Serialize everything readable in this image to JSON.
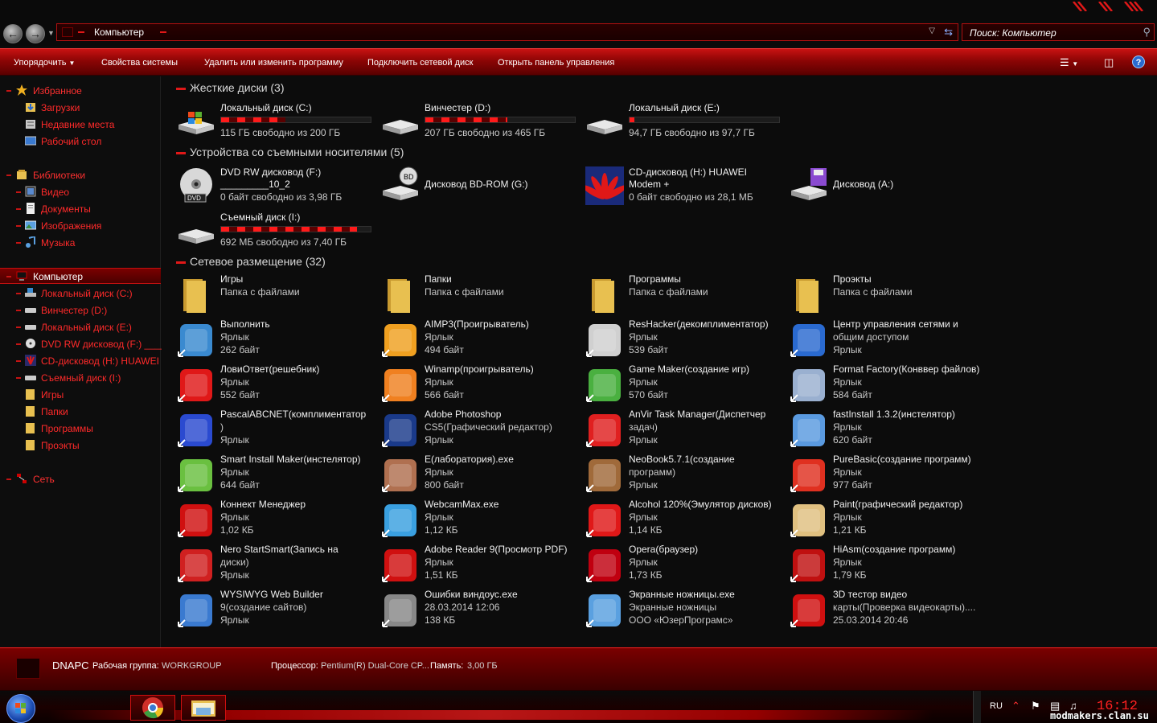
{
  "window": {
    "address": "Компьютер",
    "search_placeholder": "Поиск: Компьютер"
  },
  "toolbar": {
    "organize": "Упорядочить",
    "system_props": "Свойства системы",
    "uninstall": "Удалить или изменить программу",
    "map_drive": "Подключить сетевой диск",
    "control_panel": "Открыть панель управления"
  },
  "sidebar": {
    "favorites": {
      "label": "Избранное",
      "items": [
        {
          "label": "Загрузки"
        },
        {
          "label": "Недавние места"
        },
        {
          "label": "Рабочий стол"
        }
      ]
    },
    "libraries": {
      "label": "Библиотеки",
      "items": [
        {
          "label": "Видео"
        },
        {
          "label": "Документы"
        },
        {
          "label": "Изображения"
        },
        {
          "label": "Музыка"
        }
      ]
    },
    "computer": {
      "label": "Компьютер",
      "items": [
        {
          "label": "Локальный диск (C:)"
        },
        {
          "label": "Винчестер (D:)"
        },
        {
          "label": "Локальный диск (E:)"
        },
        {
          "label": "DVD RW дисковод (F:) ____"
        },
        {
          "label": "CD-дисковод (H:) HUAWEI"
        },
        {
          "label": "Съемный диск (I:)"
        },
        {
          "label": "Игры"
        },
        {
          "label": "Папки"
        },
        {
          "label": "Программы"
        },
        {
          "label": "Проэкты"
        }
      ]
    },
    "network": {
      "label": "Сеть"
    }
  },
  "groups": {
    "hdd": "Жесткие диски (3)",
    "removable": "Устройства со съемными носителями (5)",
    "network": "Сетевое размещение (32)"
  },
  "hdd": [
    {
      "name": "Локальный диск (C:)",
      "free": "115 ГБ свободно из 200 ГБ",
      "used_fraction": 0.43
    },
    {
      "name": "Винчестер (D:)",
      "free": "207 ГБ свободно из 465 ГБ",
      "used_fraction": 0.55
    },
    {
      "name": "Локальный диск (E:)",
      "free": "94,7 ГБ свободно из 97,7 ГБ",
      "used_fraction": 0.03
    }
  ],
  "removable": [
    {
      "l1": "DVD RW дисковод (F:)",
      "l2": "_________10_2",
      "l3": "0 байт свободно из 3,98 ГБ"
    },
    {
      "l1": "Дисковод BD-ROM (G:)"
    },
    {
      "l1": "CD-дисковод (H:) HUAWEI",
      "l2": "Modem +",
      "l3": "0 байт свободно из 28,1 МБ"
    },
    {
      "l1": "Дисковод (A:)"
    },
    {
      "l1": "Съемный диск (I:)",
      "l3": "692 МБ свободно из 7,40 ГБ",
      "used_fraction": 0.91
    }
  ],
  "network_items": [
    {
      "l1": "Игры",
      "l2": "Папка с файлами",
      "icon": "folder-icon"
    },
    {
      "l1": "Папки",
      "l2": "Папка с файлами",
      "icon": "folder-icon"
    },
    {
      "l1": "Программы",
      "l2": "Папка с файлами",
      "icon": "folder-icon"
    },
    {
      "l1": "Проэкты",
      "l2": "Папка с файлами",
      "icon": "folder-icon"
    },
    {
      "l1": "Выполнить",
      "l2": "Ярлык",
      "l3": "262 байт",
      "icon": "run-icon"
    },
    {
      "l1": "AIMP3(Проигрыватель)",
      "l2": "Ярлык",
      "l3": "494 байт",
      "icon": "aimp-icon"
    },
    {
      "l1": "ResHacker(декомплиментатор)",
      "l2": "Ярлык",
      "l3": "539 байт",
      "icon": "reshacker-icon"
    },
    {
      "l1": "Центр управления сетями и",
      "l2": "общим доступом",
      "l3": "Ярлык",
      "icon": "network-center-icon"
    },
    {
      "l1": "ЛовиОтвет(решебник)",
      "l2": "Ярлык",
      "l3": "552 байт",
      "icon": "loviotvet-icon"
    },
    {
      "l1": "Winamp(проигрыватель)",
      "l2": "Ярлык",
      "l3": "566 байт",
      "icon": "winamp-icon"
    },
    {
      "l1": "Game Maker(создание игр)",
      "l2": "Ярлык",
      "l3": "570 байт",
      "icon": "gamemaker-icon"
    },
    {
      "l1": "Format Factory(Конввер файлов)",
      "l2": "Ярлык",
      "l3": "584 байт",
      "icon": "formatfactory-icon"
    },
    {
      "l1": "PascalABCNET(комплиментатор",
      "l2": ")",
      "l3": "Ярлык",
      "icon": "pascal-icon"
    },
    {
      "l1": "Adobe Photoshop",
      "l2": "CS5(Графический редактор)",
      "l3": "Ярлык",
      "icon": "photoshop-icon"
    },
    {
      "l1": "AnVir Task Manager(Диспетчер",
      "l2": "задач)",
      "l3": "Ярлык",
      "icon": "anvir-icon"
    },
    {
      "l1": "fastInstall 1.3.2(инстелятор)",
      "l2": "Ярлык",
      "l3": "620 байт",
      "icon": "fastinstall-icon"
    },
    {
      "l1": "Smart Install Maker(инстелятор)",
      "l2": "Ярлык",
      "l3": "644 байт",
      "icon": "smartinstall-icon"
    },
    {
      "l1": "E(лаборатория).exe",
      "l2": "Ярлык",
      "l3": "800 байт",
      "icon": "molecule-icon"
    },
    {
      "l1": "NeoBook5.7.1(создание",
      "l2": "программ)",
      "l3": "Ярлык",
      "icon": "neobook-icon"
    },
    {
      "l1": "PureBasic(создание программ)",
      "l2": "Ярлык",
      "l3": "977 байт",
      "icon": "purebasic-icon"
    },
    {
      "l1": "Коннект Менеджер",
      "l2": "Ярлык",
      "l3": "1,02 КБ",
      "icon": "connect-manager-icon"
    },
    {
      "l1": "WebcamMax.exe",
      "l2": "Ярлык",
      "l3": "1,12 КБ",
      "icon": "webcam-icon"
    },
    {
      "l1": "Alcohol 120%(Эмулятор дисков)",
      "l2": "Ярлык",
      "l3": "1,14 КБ",
      "icon": "alcohol-icon"
    },
    {
      "l1": "Paint(графический редактор)",
      "l2": "Ярлык",
      "l3": "1,21 КБ",
      "icon": "paint-icon"
    },
    {
      "l1": "Nero StartSmart(Запись на",
      "l2": "диски)",
      "l3": "Ярлык",
      "icon": "nero-icon"
    },
    {
      "l1": "Adobe Reader 9(Просмотр PDF)",
      "l2": "Ярлык",
      "l3": "1,51 КБ",
      "icon": "adobe-reader-icon"
    },
    {
      "l1": "Opera(браузер)",
      "l2": "Ярлык",
      "l3": "1,73 КБ",
      "icon": "opera-icon"
    },
    {
      "l1": "HiAsm(создание программ)",
      "l2": "Ярлык",
      "l3": "1,79 КБ",
      "icon": "hiasm-icon"
    },
    {
      "l1": "WYSIWYG Web Builder",
      "l2": "9(создание сайтов)",
      "l3": "Ярлык",
      "icon": "wysiwyg-icon"
    },
    {
      "l1": "Ошибки виндоус.exe",
      "l2": "28.03.2014 12:06",
      "l3": "138 КБ",
      "icon": "face-image-icon"
    },
    {
      "l1": "Экранные ножницы.exe",
      "l2": "Экранные ножницы",
      "l3": "ООО «ЮзерПрограмс»",
      "icon": "snipping-icon"
    },
    {
      "l1": "3D тестор видео",
      "l2": "карты(Проверка видеокарты)....",
      "l3": "25.03.2014 20:46",
      "icon": "ati-icon"
    }
  ],
  "details": {
    "computer_name": "DNAPC",
    "workgroup_label": "Рабочая группа:",
    "workgroup": "WORKGROUP",
    "cpu_label": "Процессор:",
    "cpu": "Pentium(R) Dual-Core  CP...",
    "ram_label": "Память:",
    "ram": "3,00 ГБ"
  },
  "taskbar": {
    "lang": "RU",
    "clock": "16:12",
    "watermark": "modmakers.clan.su"
  }
}
